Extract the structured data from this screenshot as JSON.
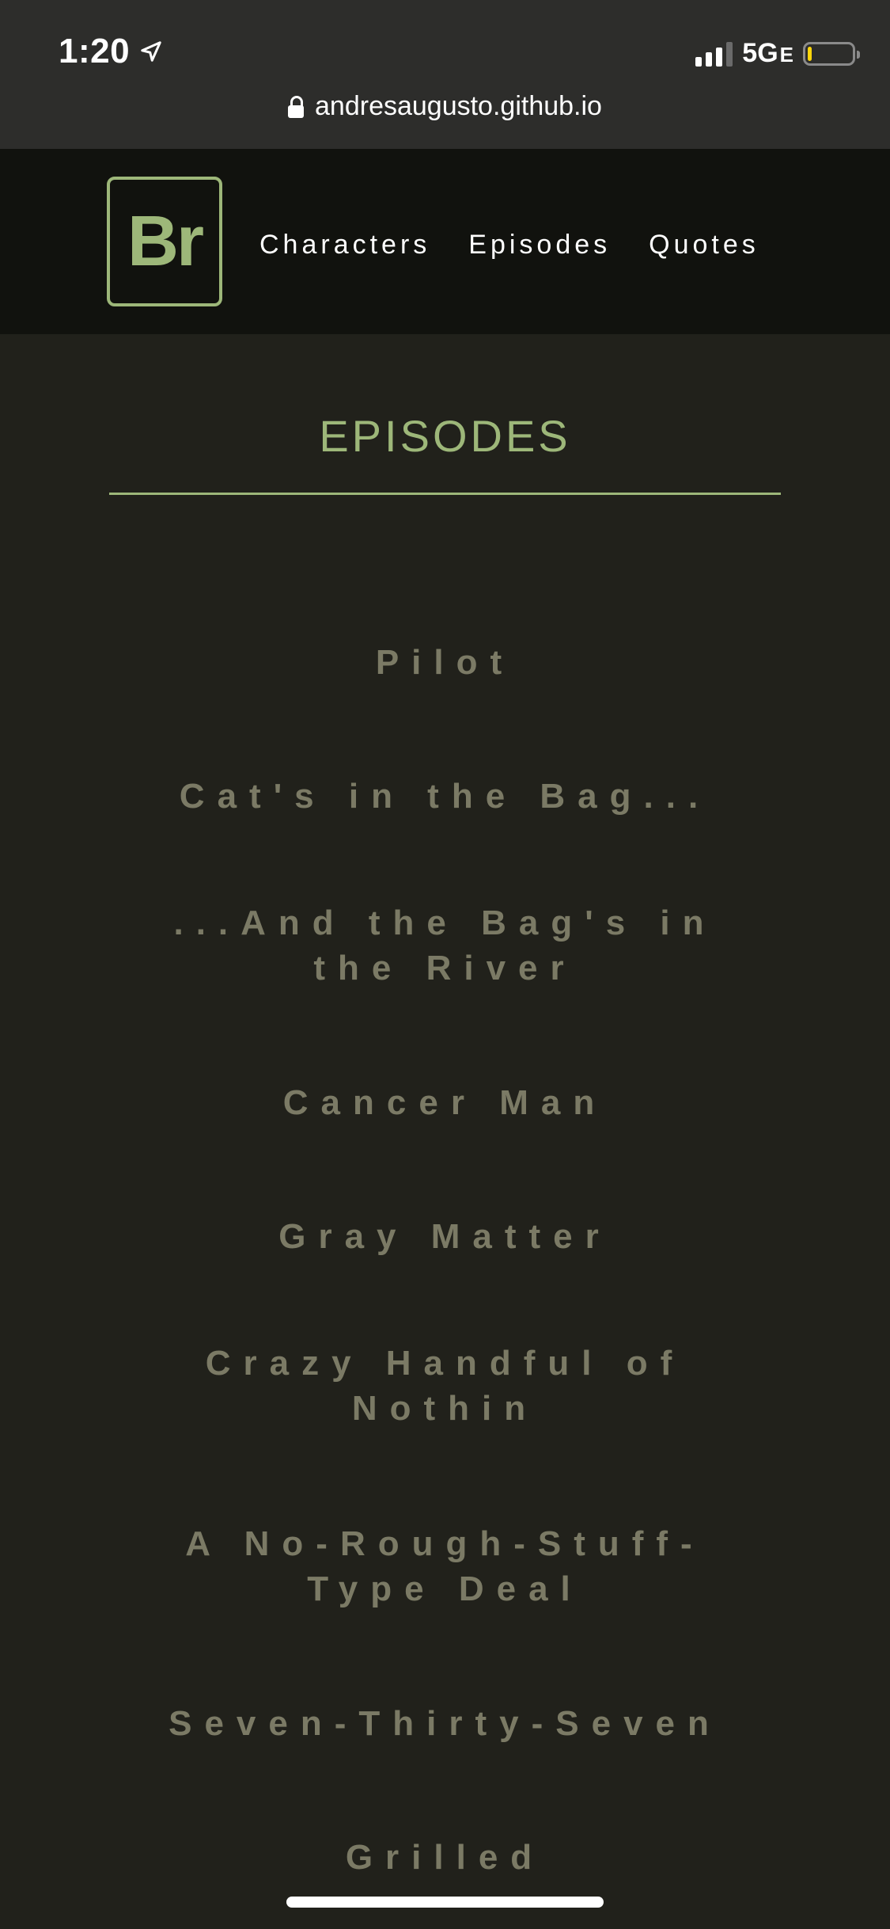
{
  "status_bar": {
    "time": "1:20",
    "network_main": "5G",
    "network_sub": "E",
    "battery_level": 0.1,
    "battery_color": "#ffd60a"
  },
  "browser": {
    "url": "andresaugusto.github.io",
    "lock_icon": "lock-icon"
  },
  "header": {
    "logo_text": "Br",
    "nav": [
      {
        "label": "Characters"
      },
      {
        "label": "Episodes"
      },
      {
        "label": "Quotes"
      }
    ]
  },
  "main": {
    "title": "EPISODES",
    "episodes": [
      {
        "title": "Pilot"
      },
      {
        "title": "Cat's in the Bag..."
      },
      {
        "title": "...And the Bag's in the River"
      },
      {
        "title": "Cancer Man"
      },
      {
        "title": "Gray Matter"
      },
      {
        "title": "Crazy Handful of Nothin"
      },
      {
        "title": "A No-Rough-Stuff-Type Deal"
      },
      {
        "title": "Seven-Thirty-Seven"
      },
      {
        "title": "Grilled"
      }
    ]
  },
  "colors": {
    "accent": "#9db779",
    "background": "#21211b",
    "header_bg": "#11120e",
    "episode_text": "#7b7a65"
  }
}
